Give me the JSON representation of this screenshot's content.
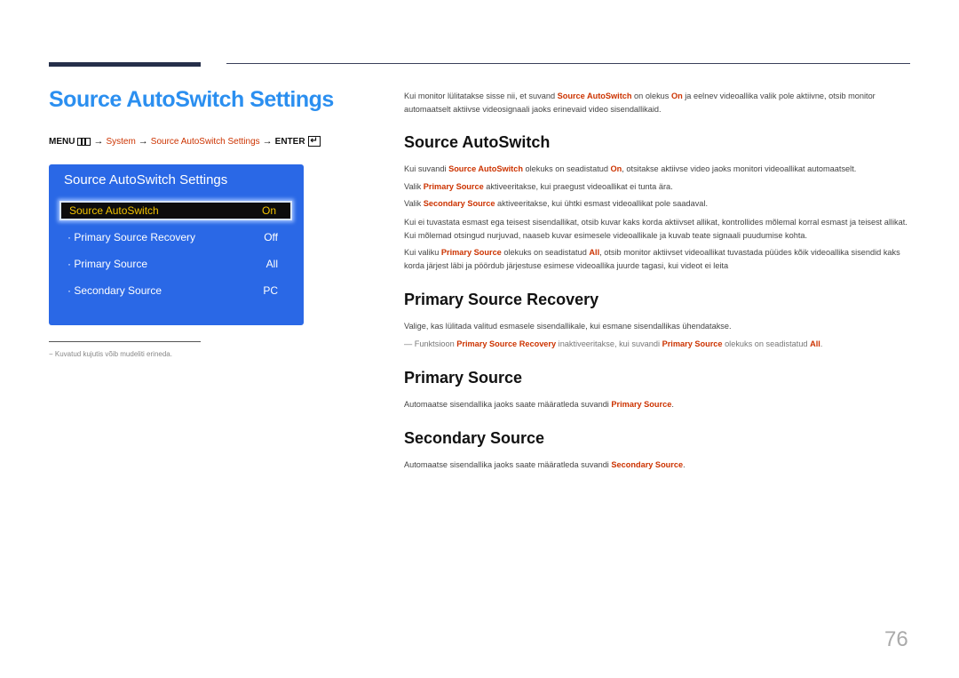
{
  "page_title": "Source AutoSwitch Settings",
  "menu_path": {
    "menu": "MENU",
    "arrow": "→",
    "system": "System",
    "item": "Source AutoSwitch Settings",
    "enter": "ENTER",
    "enter_glyph": "↵"
  },
  "osd": {
    "title": "Source AutoSwitch Settings",
    "rows": [
      {
        "label": "Source AutoSwitch",
        "value": "On"
      },
      {
        "label": "· Primary Source Recovery",
        "value": "Off"
      },
      {
        "label": "· Primary Source",
        "value": "All"
      },
      {
        "label": "· Secondary Source",
        "value": "PC"
      }
    ]
  },
  "footnote": "−  Kuvatud kujutis võib mudeliti erineda.",
  "intro": {
    "t1": "Kui monitor lülitatakse sisse nii, et suvand ",
    "b1": "Source AutoSwitch",
    "t2": " on olekus ",
    "b2": "On",
    "t3": " ja eelnev videoallika valik pole aktiivne, otsib monitor automaatselt aktiivse videosignaali jaoks erinevaid video sisendallikaid."
  },
  "sections": {
    "autoswitch": {
      "heading": "Source AutoSwitch",
      "p1": {
        "t1": "Kui suvandi ",
        "b1": "Source AutoSwitch",
        "t2": " olekuks on seadistatud ",
        "b2": "On",
        "t3": ", otsitakse aktiivse video jaoks monitori videoallikat automaatselt."
      },
      "p2": {
        "t1": "Valik ",
        "b1": "Primary Source",
        "t2": " aktiveeritakse, kui praegust videoallikat ei tunta ära."
      },
      "p3": {
        "t1": "Valik ",
        "b1": "Secondary Source",
        "t2": " aktiveeritakse, kui ühtki esmast videoallikat pole saadaval."
      },
      "p4": "Kui ei tuvastata esmast ega teisest sisendallikat, otsib kuvar kaks korda aktiivset allikat, kontrollides mõlemal korral esmast ja teisest allikat. Kui mõlemad otsingud nurjuvad, naaseb kuvar esimesele videoallikale ja kuvab teate signaali puudumise kohta.",
      "p5": {
        "t1": "Kui valiku ",
        "b1": "Primary Source",
        "t2": " olekuks on seadistatud ",
        "b2": "All",
        "t3": ", otsib monitor aktiivset videoallikat tuvastada püüdes kõik videoallika sisendid kaks korda järjest läbi ja pöördub järjestuse esimese videoallika juurde tagasi, kui videot ei leita"
      }
    },
    "recovery": {
      "heading": "Primary Source Recovery",
      "p1": "Valige, kas lülitada valitud esmasele sisendallikale, kui esmane sisendallikas ühendatakse.",
      "note": {
        "dash": "― ",
        "t1": "Funktsioon ",
        "b1": "Primary Source Recovery",
        "t2": " inaktiveeritakse, kui suvandi ",
        "b2": "Primary Source",
        "t3": " olekuks on seadistatud ",
        "b3": "All",
        "t4": "."
      }
    },
    "primary": {
      "heading": "Primary Source",
      "p1": {
        "t1": "Automaatse sisendallika jaoks saate määratleda suvandi ",
        "b1": "Primary Source",
        "t2": "."
      }
    },
    "secondary": {
      "heading": "Secondary Source",
      "p1": {
        "t1": "Automaatse sisendallika jaoks saate määratleda suvandi ",
        "b1": "Secondary Source",
        "t2": "."
      }
    }
  },
  "page_number": "76",
  "colors": {
    "title_blue": "#2b8ff0",
    "highlight_red": "#cc3300",
    "osd_blue": "#2a68e6",
    "osd_selected_text": "#f3c400"
  }
}
